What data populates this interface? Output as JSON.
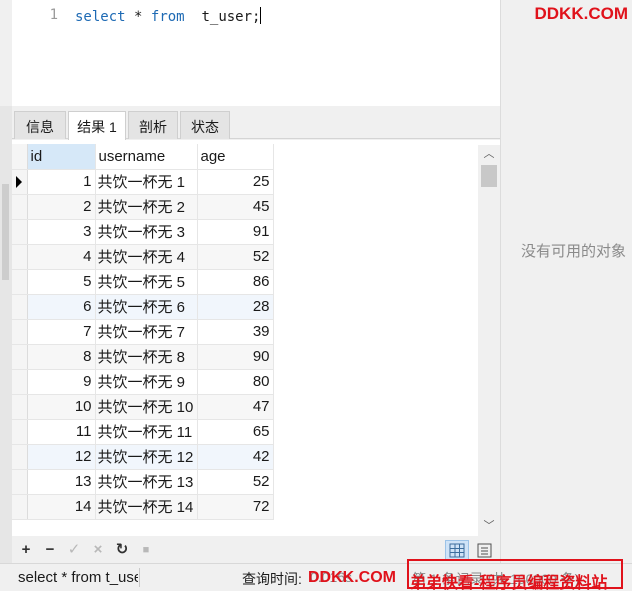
{
  "editor": {
    "line_number": "1",
    "kw_select": "select",
    "star": "*",
    "kw_from": "from",
    "table": "t_user;"
  },
  "watermark": {
    "top": "DDKK.COM",
    "bottom_left": "DDKK.COM",
    "bottom_right": "弟弟快看-程序员编程资料站"
  },
  "tabs": [
    {
      "label": "信息"
    },
    {
      "label": "结果 1"
    },
    {
      "label": "剖析"
    },
    {
      "label": "状态"
    }
  ],
  "grid": {
    "columns": [
      "id",
      "username",
      "age"
    ],
    "rows": [
      {
        "id": "1",
        "username": "共饮一杯无 1",
        "age": "25"
      },
      {
        "id": "2",
        "username": "共饮一杯无 2",
        "age": "45"
      },
      {
        "id": "3",
        "username": "共饮一杯无 3",
        "age": "91"
      },
      {
        "id": "4",
        "username": "共饮一杯无 4",
        "age": "52"
      },
      {
        "id": "5",
        "username": "共饮一杯无 5",
        "age": "86"
      },
      {
        "id": "6",
        "username": "共饮一杯无 6",
        "age": "28"
      },
      {
        "id": "7",
        "username": "共饮一杯无 7",
        "age": "39"
      },
      {
        "id": "8",
        "username": "共饮一杯无 8",
        "age": "90"
      },
      {
        "id": "9",
        "username": "共饮一杯无 9",
        "age": "80"
      },
      {
        "id": "10",
        "username": "共饮一杯无 10",
        "age": "47"
      },
      {
        "id": "11",
        "username": "共饮一杯无 11",
        "age": "65"
      },
      {
        "id": "12",
        "username": "共饮一杯无 12",
        "age": "42"
      },
      {
        "id": "13",
        "username": "共饮一杯无 13",
        "age": "52"
      },
      {
        "id": "14",
        "username": "共饮一杯无 14",
        "age": "72"
      }
    ]
  },
  "toolbar": {
    "add": "+",
    "remove": "−",
    "apply": "✓",
    "discard": "×",
    "refresh": "↻",
    "stop": "■"
  },
  "status": {
    "sql": "select * from  t_user;",
    "time_label": "查询时间:",
    "time_value": "0.016s",
    "records": "第 1 条记录 (共 100000 条)"
  },
  "right_panel": {
    "message": "没有可用的对象"
  },
  "colors": {
    "keyword": "#1e6ab4",
    "watermark": "#e0121b",
    "selected_header": "#d6e8f8"
  }
}
